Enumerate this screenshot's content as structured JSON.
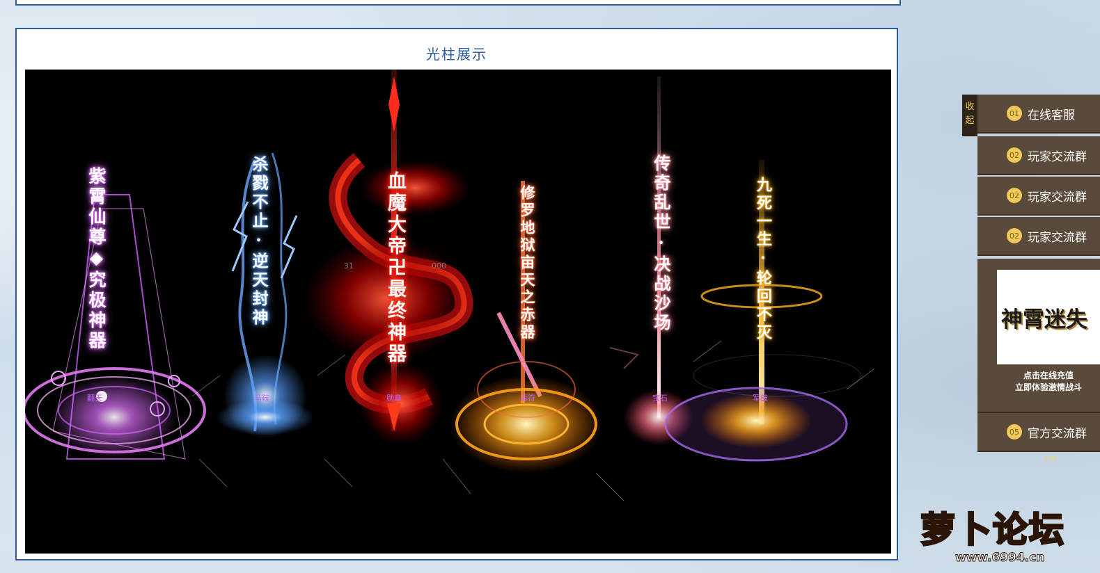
{
  "panel": {
    "title": "光柱展示"
  },
  "pillars": [
    {
      "id": "zixiao",
      "text": "紫霄仙尊◆究极神器",
      "label": "翻天",
      "color": "#e070ff",
      "label_color": "#c060ff"
    },
    {
      "id": "shazhan",
      "text": "杀戮不止·逆天封神",
      "label": "马鞍",
      "color": "#6aa8ff",
      "label_color": "#c060ff"
    },
    {
      "id": "xuemo",
      "text": "血魔大帝卍最终神器",
      "label": "勋章",
      "color": "#ff2a1a",
      "label_color": "#c060ff"
    },
    {
      "id": "xiuluo",
      "text": "修罗地狱亩天之赤器",
      "label": "毒符",
      "color": "#ff6a3a",
      "label_color": "#c060ff"
    },
    {
      "id": "chuanqi",
      "text": "传奇乱世·决战沙场",
      "label": "宝石",
      "color": "#ff8a9a",
      "label_color": "#c060ff"
    },
    {
      "id": "jiusi",
      "text": "九死一生·轮回不灭",
      "label": "军鼓",
      "color": "#ffb020",
      "label_color": "#c060ff"
    }
  ],
  "stage_misc": {
    "faint_left": "31",
    "faint_right": "000"
  },
  "side_panel": {
    "collapse_label": "收起",
    "items": [
      {
        "num": "01",
        "label": "在线客服"
      },
      {
        "num": "02",
        "label": "玩家交流群"
      },
      {
        "num": "02",
        "label": "玩家交流群"
      },
      {
        "num": "02",
        "label": "玩家交流群"
      }
    ],
    "promo": {
      "logo_text": "神霄迷失",
      "caption_line1": "点击在线充值",
      "caption_line2": "立即体验激情战斗"
    },
    "bottom_item": {
      "num": "05",
      "label": "官方交流群"
    },
    "tiny_text": "TOP"
  },
  "watermark": {
    "text": "萝卜论坛",
    "url": "www.6994.cn"
  }
}
